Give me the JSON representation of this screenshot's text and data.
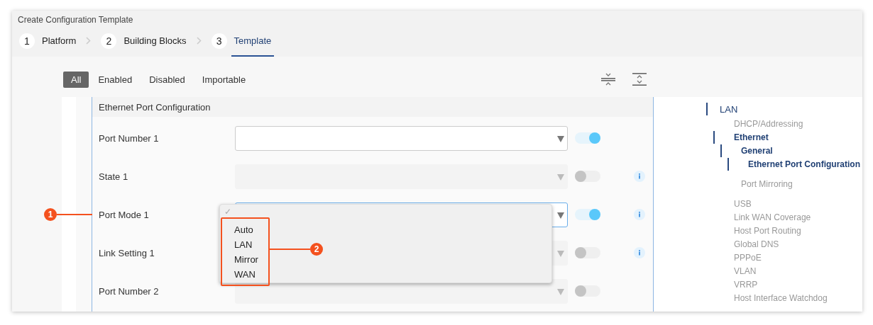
{
  "window": {
    "title": "Create Configuration Template"
  },
  "steps": [
    {
      "number": "1",
      "label": "Platform",
      "selected": false
    },
    {
      "number": "2",
      "label": "Building Blocks",
      "selected": false
    },
    {
      "number": "3",
      "label": "Template",
      "selected": true
    }
  ],
  "filters": [
    {
      "label": "All",
      "selected": true
    },
    {
      "label": "Enabled",
      "selected": false
    },
    {
      "label": "Disabled",
      "selected": false
    },
    {
      "label": "Importable",
      "selected": false
    }
  ],
  "panel": {
    "title": "Ethernet Port Configuration",
    "fields": [
      {
        "label": "Port Number 1",
        "disabled": false,
        "focused": false,
        "on": true,
        "info": false
      },
      {
        "label": "State 1",
        "disabled": true,
        "focused": false,
        "on": false,
        "info": true
      },
      {
        "label": "Port Mode 1",
        "disabled": false,
        "focused": true,
        "on": true,
        "info": true,
        "callout": "1"
      },
      {
        "label": "Link Setting 1",
        "disabled": true,
        "focused": false,
        "on": false,
        "info": true
      },
      {
        "label": "Port Number 2",
        "disabled": true,
        "focused": false,
        "on": false,
        "info": false
      }
    ]
  },
  "dropdown": {
    "check_mark": "✓",
    "callout": "2",
    "options": [
      "Auto",
      "LAN",
      "Mirror",
      "WAN"
    ]
  },
  "nav": [
    {
      "label": "LAN",
      "active": true,
      "children": [
        {
          "label": "DHCP/Addressing",
          "active": false
        },
        {
          "label": "Ethernet",
          "active": true,
          "children": [
            {
              "label": "General",
              "active": true,
              "children": [
                {
                  "label": "Ethernet Port Configuration",
                  "active": true
                }
              ]
            },
            {
              "label": "Port Mirroring",
              "active": false
            }
          ]
        },
        {
          "label": "USB",
          "active": false
        },
        {
          "label": "Link WAN Coverage",
          "active": false
        },
        {
          "label": "Host Port Routing",
          "active": false
        },
        {
          "label": "Global DNS",
          "active": false
        },
        {
          "label": "PPPoE",
          "active": false
        },
        {
          "label": "VLAN",
          "active": false
        },
        {
          "label": "VRRP",
          "active": false
        },
        {
          "label": "Host Interface Watchdog",
          "active": false
        }
      ]
    }
  ]
}
